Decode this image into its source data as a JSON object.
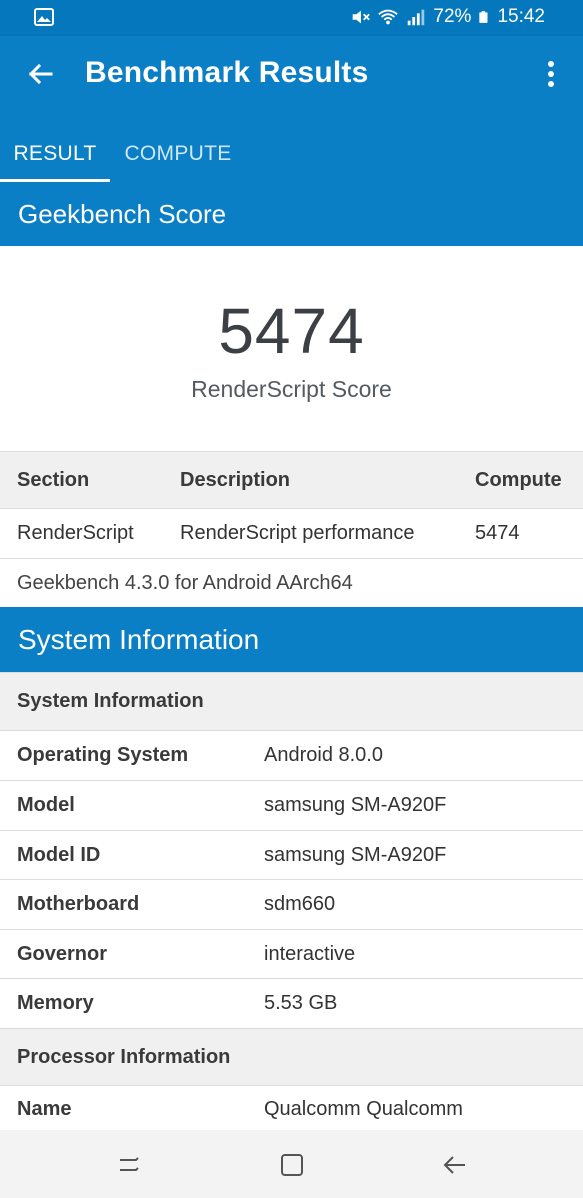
{
  "status_bar": {
    "battery": "72%",
    "time": "15:42",
    "icons": [
      "gallery-icon",
      "mute-icon",
      "wifi-icon",
      "signal-icon",
      "battery-icon"
    ]
  },
  "app_bar": {
    "title": "Benchmark Results",
    "tabs": [
      {
        "label": "RESULT",
        "selected": true
      },
      {
        "label": "COMPUTE",
        "selected": false
      }
    ]
  },
  "geekbench": {
    "header": "Geekbench Score",
    "score": "5474",
    "score_label": "RenderScript Score",
    "table": {
      "columns": [
        "Section",
        "Description",
        "Compute"
      ],
      "rows": [
        [
          "RenderScript",
          "RenderScript performance",
          "5474"
        ]
      ]
    },
    "version_note": "Geekbench 4.3.0 for Android AArch64"
  },
  "system_info": {
    "header": "System Information",
    "subheader": "System Information",
    "rows": [
      {
        "label": "Operating System",
        "value": "Android 8.0.0"
      },
      {
        "label": "Model",
        "value": "samsung SM-A920F"
      },
      {
        "label": "Model ID",
        "value": "samsung SM-A920F"
      },
      {
        "label": "Motherboard",
        "value": "sdm660"
      },
      {
        "label": "Governor",
        "value": "interactive"
      },
      {
        "label": "Memory",
        "value": "5.53 GB"
      }
    ],
    "processor_subheader": "Processor Information",
    "processor_rows": [
      {
        "label": "Name",
        "value": "Qualcomm Qualcomm"
      }
    ]
  },
  "colors": {
    "primary": "#0a7fc6",
    "status_bar": "#0577bd",
    "table_header_bg": "#f0f0f0"
  }
}
